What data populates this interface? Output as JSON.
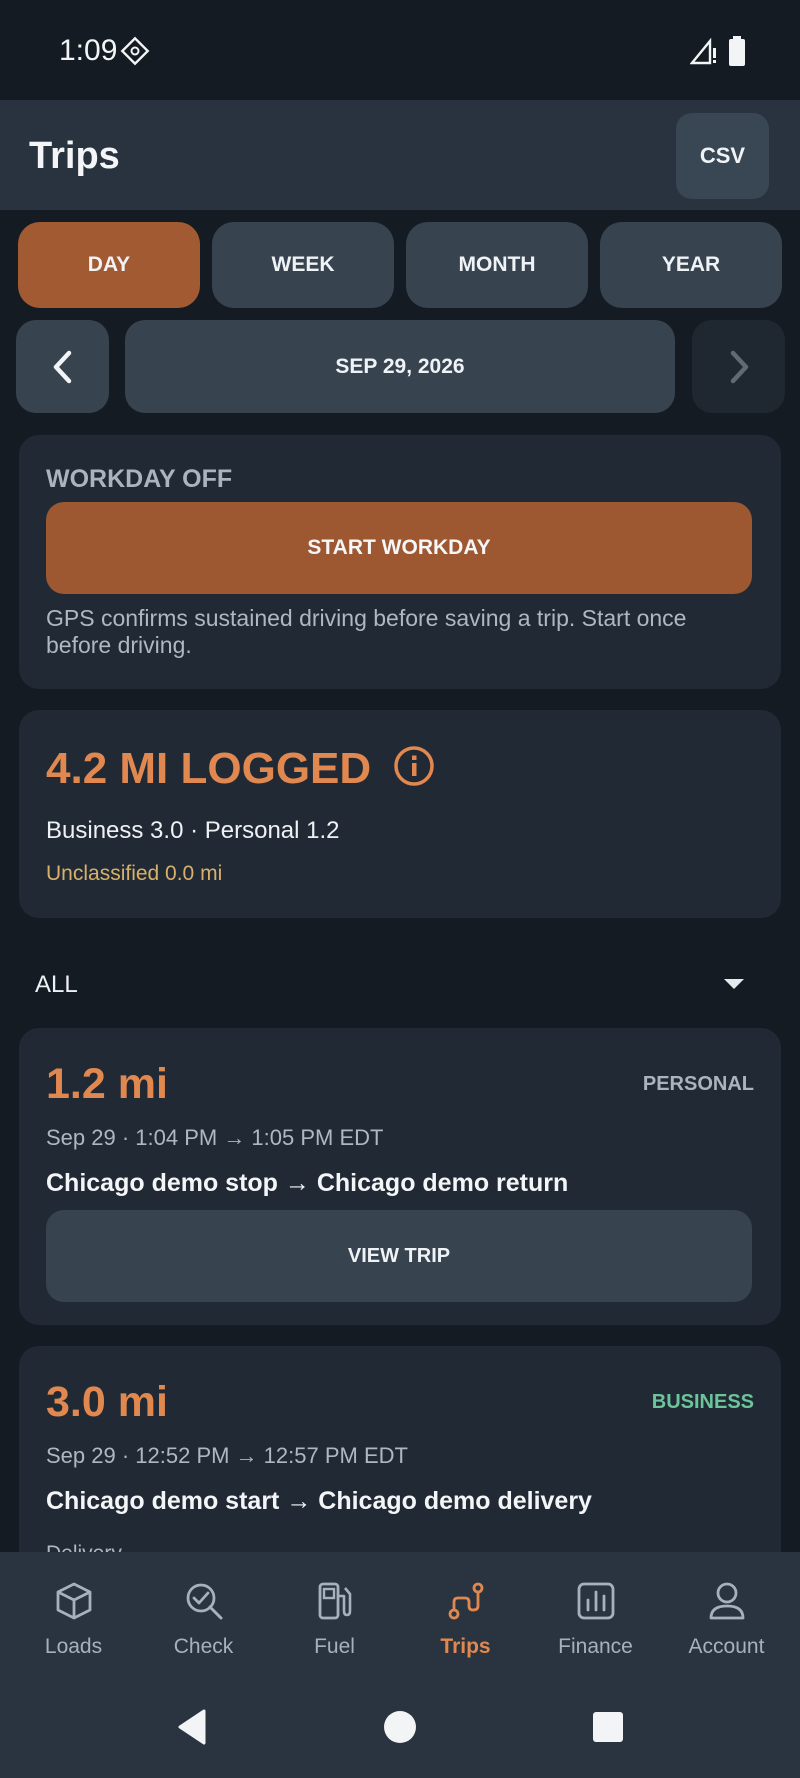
{
  "status_bar": {
    "time": "1:09"
  },
  "header": {
    "title": "Trips",
    "csv_label": "CSV"
  },
  "periods": [
    "DAY",
    "WEEK",
    "MONTH",
    "YEAR"
  ],
  "date_label": "SEP 29, 2026",
  "workday": {
    "status": "WORKDAY OFF",
    "button_label": "START WORKDAY",
    "note": "GPS confirms sustained driving before saving a trip. Start once before driving."
  },
  "summary": {
    "title": "4.2 MI LOGGED",
    "breakdown": "Business 3.0 · Personal 1.2",
    "unclassified": "Unclassified 0.0 mi"
  },
  "filter": {
    "value": "ALL"
  },
  "trips": [
    {
      "distance": "1.2 mi",
      "tag": "PERSONAL",
      "time": "Sep 29 · 1:04 PM → 1:05 PM EDT",
      "route": "Chicago demo stop → Chicago demo return",
      "button_label": "VIEW TRIP"
    },
    {
      "distance": "3.0 mi",
      "tag": "BUSINESS",
      "time": "Sep 29 · 12:52 PM → 12:57 PM EDT",
      "route": "Chicago demo start → Chicago demo delivery",
      "purpose": "Delivery"
    }
  ],
  "tabs": [
    {
      "label": "Loads",
      "icon": "box-icon"
    },
    {
      "label": "Check",
      "icon": "search-check-icon"
    },
    {
      "label": "Fuel",
      "icon": "fuel-pump-icon"
    },
    {
      "label": "Trips",
      "icon": "route-icon"
    },
    {
      "label": "Finance",
      "icon": "bar-chart-icon"
    },
    {
      "label": "Account",
      "icon": "user-icon"
    }
  ],
  "colors": {
    "accent": "#e0884f",
    "active_button": "#a15a31",
    "personal_tag": "#aab4bd",
    "business_tag": "#6cc49a",
    "unclassified": "#d9b06a"
  }
}
